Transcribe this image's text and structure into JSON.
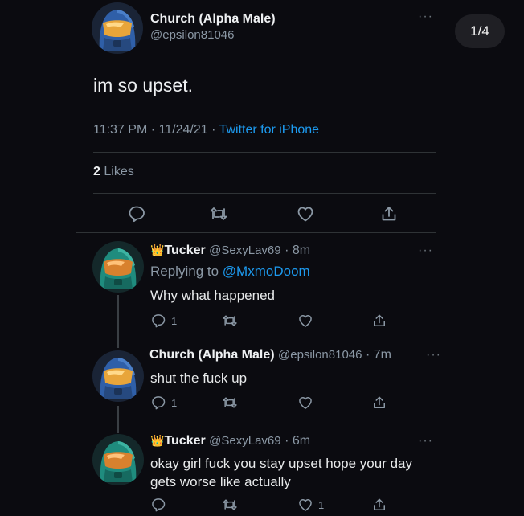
{
  "page_counter": "1/4",
  "main_tweet": {
    "display_name": "Church (Alpha Male)",
    "handle": "@epsilon81046",
    "text": "im so upset.",
    "time": "11:37 PM",
    "date": "11/24/21",
    "separator": "·",
    "source": "Twitter for iPhone",
    "likes_count": "2",
    "likes_label": "Likes"
  },
  "replies": [
    {
      "badge": "👑",
      "display_name": "Tucker",
      "handle": "@SexyLav69",
      "age": "· 8m",
      "replying_prefix": "Replying to",
      "replying_to": "@MxmoDoom",
      "text": "Why what happened",
      "reply_count": "1"
    },
    {
      "display_name": "Church (Alpha Male)",
      "handle": "@epsilon81046",
      "age": "· 7m",
      "text": "shut the fuck up",
      "reply_count": "1"
    },
    {
      "badge": "👑",
      "display_name": "Tucker",
      "handle": "@SexyLav69",
      "age": "· 6m",
      "text_line1": "okay girl fuck you stay upset hope your day",
      "text_line2": "gets worse like actually",
      "like_count": "1"
    }
  ],
  "colors": {
    "background": "#0b0b10",
    "text": "#e7e9ea",
    "muted": "#8b98a5",
    "link": "#1d9bf0",
    "avatar_blue": "#2f5fa8",
    "avatar_teal": "#1f8c7e",
    "visor": "#e8a53a"
  },
  "icons": [
    "more-icon",
    "reply-icon",
    "retweet-icon",
    "like-icon",
    "share-icon"
  ]
}
